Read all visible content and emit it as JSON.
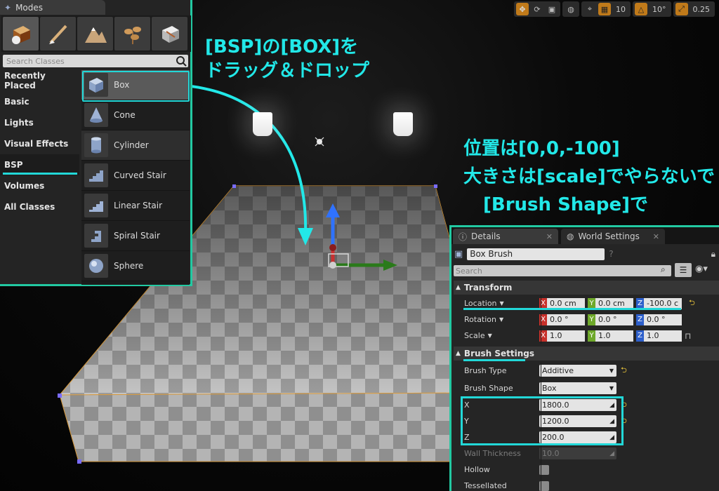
{
  "toolbar": {
    "grid_value": "10",
    "rotation_value": "10°",
    "scale_value": "0.25"
  },
  "modes": {
    "title": "Modes",
    "search_placeholder": "Search Classes",
    "categories": [
      "Recently Placed",
      "Basic",
      "Lights",
      "Visual Effects",
      "BSP",
      "Volumes",
      "All Classes"
    ],
    "selected_category": "BSP",
    "items": [
      "Box",
      "Cone",
      "Cylinder",
      "Curved Stair",
      "Linear Stair",
      "Spiral Stair",
      "Sphere"
    ]
  },
  "annotations": {
    "drag_line1": "[BSP]の[BOX]を",
    "drag_line2": "ドラッグ＆ドロップ",
    "pos_line1": "位置は[0,0,-100]",
    "pos_line2": "大きさは[scale]でやらないで",
    "pos_line3": "[Brush Shape]で"
  },
  "details": {
    "tab_details": "Details",
    "tab_world": "World Settings",
    "actor_name": "Box Brush",
    "search_placeholder": "Search",
    "transform": {
      "title": "Transform",
      "location_label": "Location",
      "location": [
        "0.0 cm",
        "0.0 cm",
        "-100.0 c"
      ],
      "rotation_label": "Rotation",
      "rotation": [
        "0.0 °",
        "0.0 °",
        "0.0 °"
      ],
      "scale_label": "Scale",
      "scale": [
        "1.0",
        "1.0",
        "1.0"
      ]
    },
    "brush": {
      "title": "Brush Settings",
      "type_label": "Brush Type",
      "type_value": "Additive",
      "shape_label": "Brush Shape",
      "shape_value": "Box",
      "x_label": "X",
      "x_value": "1800.0",
      "y_label": "Y",
      "y_value": "1200.0",
      "z_label": "Z",
      "z_value": "200.0",
      "wall_label": "Wall Thickness",
      "wall_value": "10.0",
      "hollow_label": "Hollow",
      "tess_label": "Tessellated"
    },
    "axis_letters": [
      "X",
      "Y",
      "Z"
    ]
  },
  "colors": {
    "accent_cyan": "#22d8d8",
    "panel_border": "#22c9a2",
    "axis_x": "#c8302a",
    "axis_y": "#6ea82a",
    "axis_z": "#2d5fcb"
  }
}
